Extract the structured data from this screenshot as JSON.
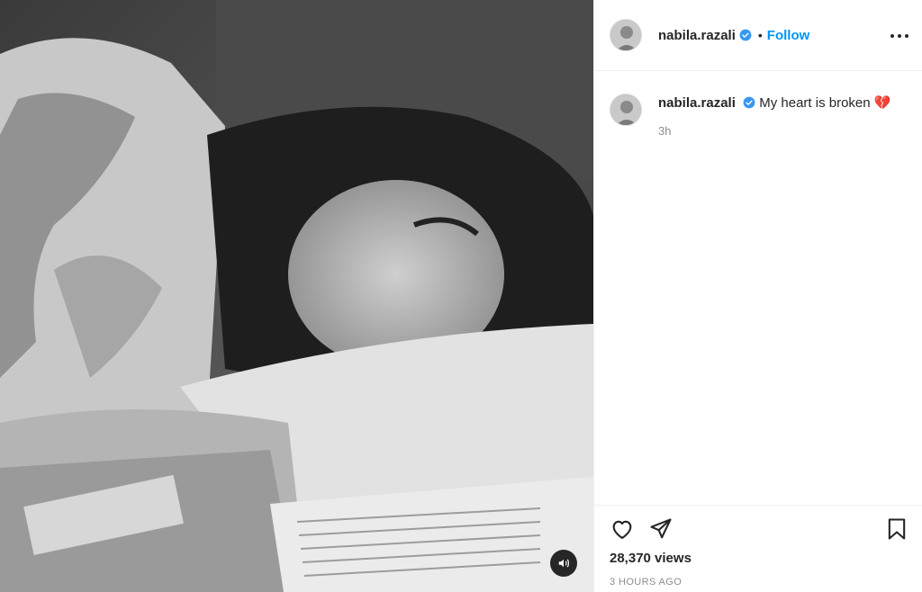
{
  "post": {
    "username": "nabila.razali",
    "follow_label": "Follow",
    "separator": "•",
    "caption_text": "My heart is broken 💔",
    "caption_time": "3h",
    "views": "28,370 views",
    "posted_ago": "3 HOURS AGO"
  },
  "icons": {
    "verified": "verified-badge-icon",
    "more": "more-options-icon",
    "like": "heart-icon",
    "share": "send-icon",
    "save": "bookmark-icon",
    "audio": "speaker-icon"
  },
  "colors": {
    "accent": "#0095f6",
    "text": "#262626",
    "muted": "#8e8e8e",
    "border": "#efefef"
  }
}
